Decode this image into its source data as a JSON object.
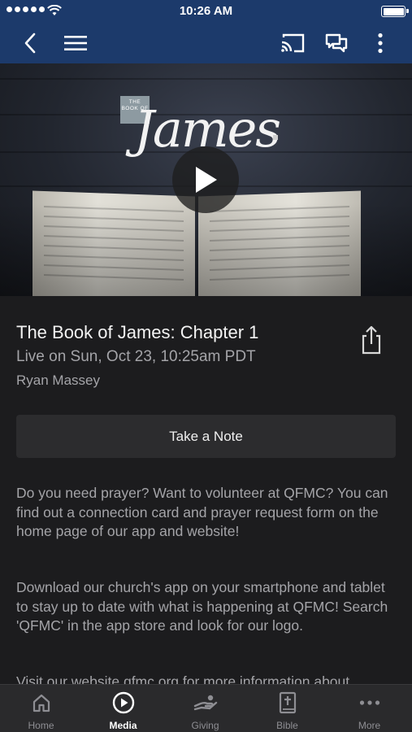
{
  "status_bar": {
    "time": "10:26 AM"
  },
  "nav": {
    "icons": [
      "back-icon",
      "menu-icon",
      "cast-icon",
      "chat-icon",
      "more-vertical-icon"
    ]
  },
  "hero": {
    "badge": "THE BOOK OF",
    "script_title": "James"
  },
  "media": {
    "title": "The Book of James: Chapter 1",
    "subtitle": "Live on Sun, Oct 23, 10:25am PDT",
    "speaker": "Ryan Massey",
    "note_button": "Take a Note",
    "paragraphs": [
      "Do you need prayer? Want to volunteer at QFMC? You can find out a connection card and prayer request form on the home page of our app and website!",
      "Download our church's app on your smartphone and tablet to stay up to date with what is happening at QFMC! Search 'QFMC' in the app store and look for our logo.",
      "Visit our website qfmc.org for more information about"
    ]
  },
  "tabs": [
    {
      "label": "Home",
      "icon": "home-icon",
      "active": false
    },
    {
      "label": "Media",
      "icon": "play-circle-icon",
      "active": true
    },
    {
      "label": "Giving",
      "icon": "giving-icon",
      "active": false
    },
    {
      "label": "Bible",
      "icon": "bible-icon",
      "active": false
    },
    {
      "label": "More",
      "icon": "more-horizontal-icon",
      "active": false
    }
  ],
  "colors": {
    "nav_background": "#1c3a6b",
    "content_background": "#1c1c1e",
    "tab_bar_background": "#2a2a2c",
    "button_background": "#2c2c2e"
  }
}
